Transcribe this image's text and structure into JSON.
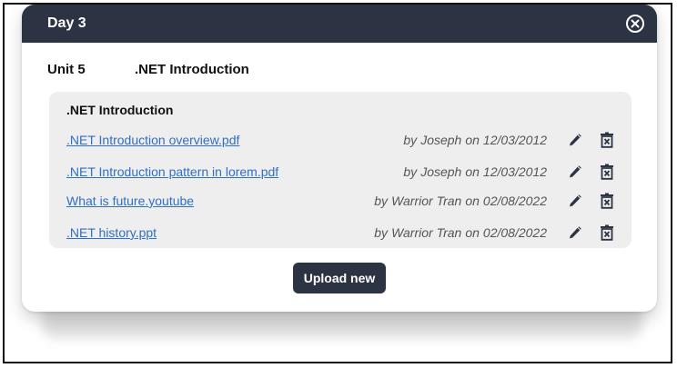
{
  "modal": {
    "title": "Day 3",
    "close_icon": "close-circle-icon"
  },
  "unit": {
    "label": "Unit 5",
    "name": ".NET Introduction"
  },
  "section": {
    "title": ".NET Introduction",
    "files": [
      {
        "name": ".NET Introduction overview.pdf",
        "by": "by",
        "author": "Joseph",
        "on": "on",
        "date": "12/03/2012"
      },
      {
        "name": ".NET Introduction pattern in lorem.pdf",
        "by": "by",
        "author": "Joseph",
        "on": "on",
        "date": "12/03/2012"
      },
      {
        "name": "What is future.youtube",
        "by": "by",
        "author": "Warrior Tran",
        "on": "on",
        "date": "02/08/2022"
      },
      {
        "name": ".NET history.ppt",
        "by": "by",
        "author": "Warrior Tran",
        "on": "on",
        "date": "02/08/2022"
      }
    ],
    "row_icons": {
      "edit": "pencil-icon",
      "delete": "trash-icon"
    }
  },
  "actions": {
    "upload_label": "Upload new"
  },
  "colors": {
    "header_bg": "#2c3444",
    "link": "#2f6fc4",
    "panel_bg": "#eeeeee",
    "meta_text": "#555555"
  }
}
